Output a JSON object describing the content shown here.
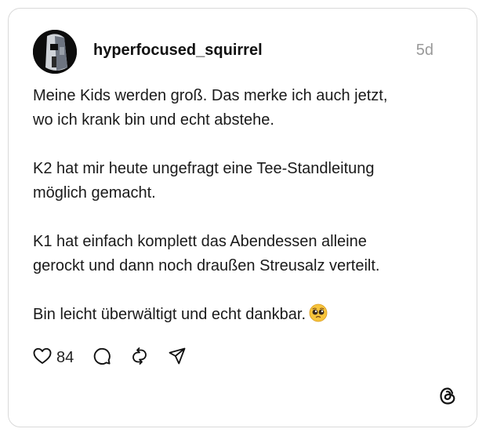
{
  "post": {
    "username": "hyperfocused_squirrel",
    "timestamp": "5d",
    "paragraphs": [
      "Meine Kids werden groß. Das merke ich  auch jetzt,\nwo ich krank bin und echt abstehe.",
      "K2 hat mir heute ungefragt eine Tee-Standleitung\nmöglich gemacht.",
      "K1 hat einfach komplett das Abendessen alleine\ngerockt und dann noch draußen Streusalz verteilt."
    ],
    "last_paragraph": "Bin leicht überwältigt und echt dankbar.",
    "emoji": "pleading-face-emoji"
  },
  "actions": {
    "like_icon": "heart-icon",
    "like_count": "84",
    "reply_icon": "comment-icon",
    "repost_icon": "repost-icon",
    "share_icon": "share-icon"
  },
  "brand": {
    "icon": "threads-logo-icon"
  }
}
